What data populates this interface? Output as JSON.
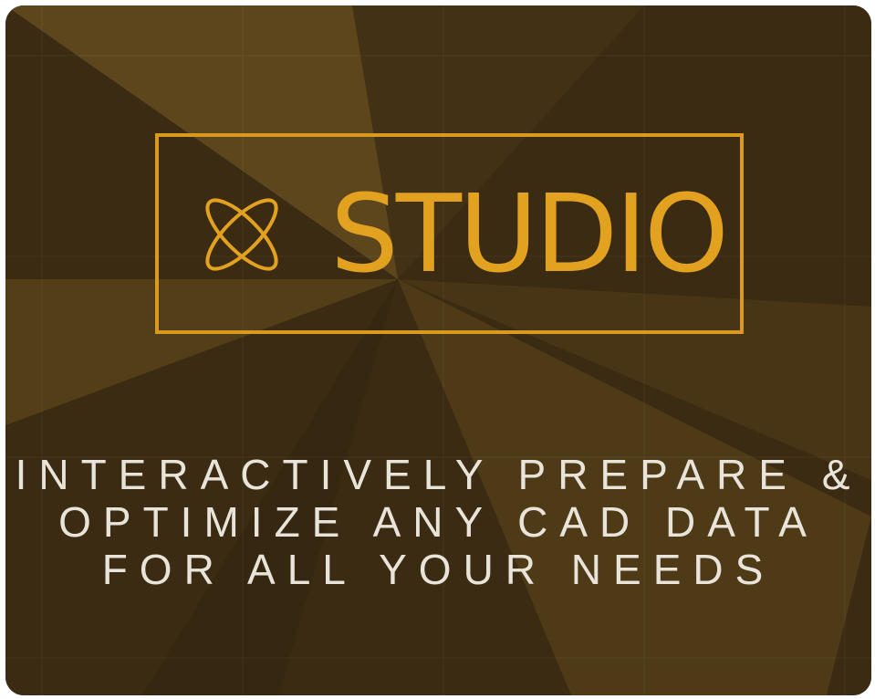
{
  "colors": {
    "background": "#3a2b12",
    "accent": "#e2a220",
    "text": "#e9e4da"
  },
  "logo": {
    "icon": "knot-icon",
    "text": "STUDIO"
  },
  "tagline": {
    "line1": "INTERACTIVELY PREPARE &",
    "line2": "OPTIMIZE ANY CAD DATA",
    "line3": "FOR ALL YOUR NEEDS"
  }
}
